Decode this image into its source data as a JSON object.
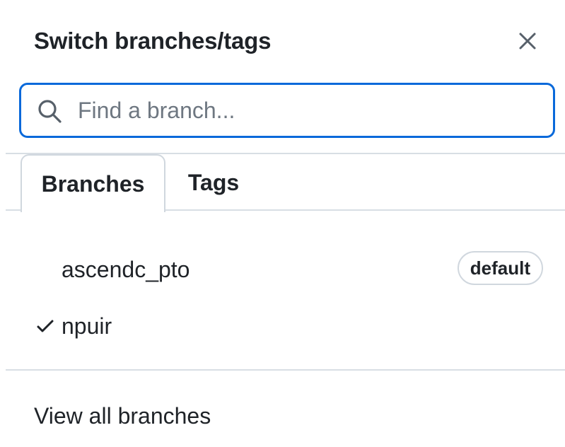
{
  "header": {
    "title": "Switch branches/tags",
    "close_icon": "close-icon"
  },
  "search": {
    "placeholder": "Find a branch...",
    "value": "",
    "icon": "search-icon",
    "focus_color": "#0969da"
  },
  "tabs": [
    {
      "label": "Branches",
      "active": true
    },
    {
      "label": "Tags",
      "active": false
    }
  ],
  "branches": [
    {
      "name": "ascendc_pto",
      "badge": "default",
      "checked": false
    },
    {
      "name": "npuir",
      "badge": "",
      "checked": true
    }
  ],
  "footer": {
    "view_all_label": "View all branches"
  }
}
